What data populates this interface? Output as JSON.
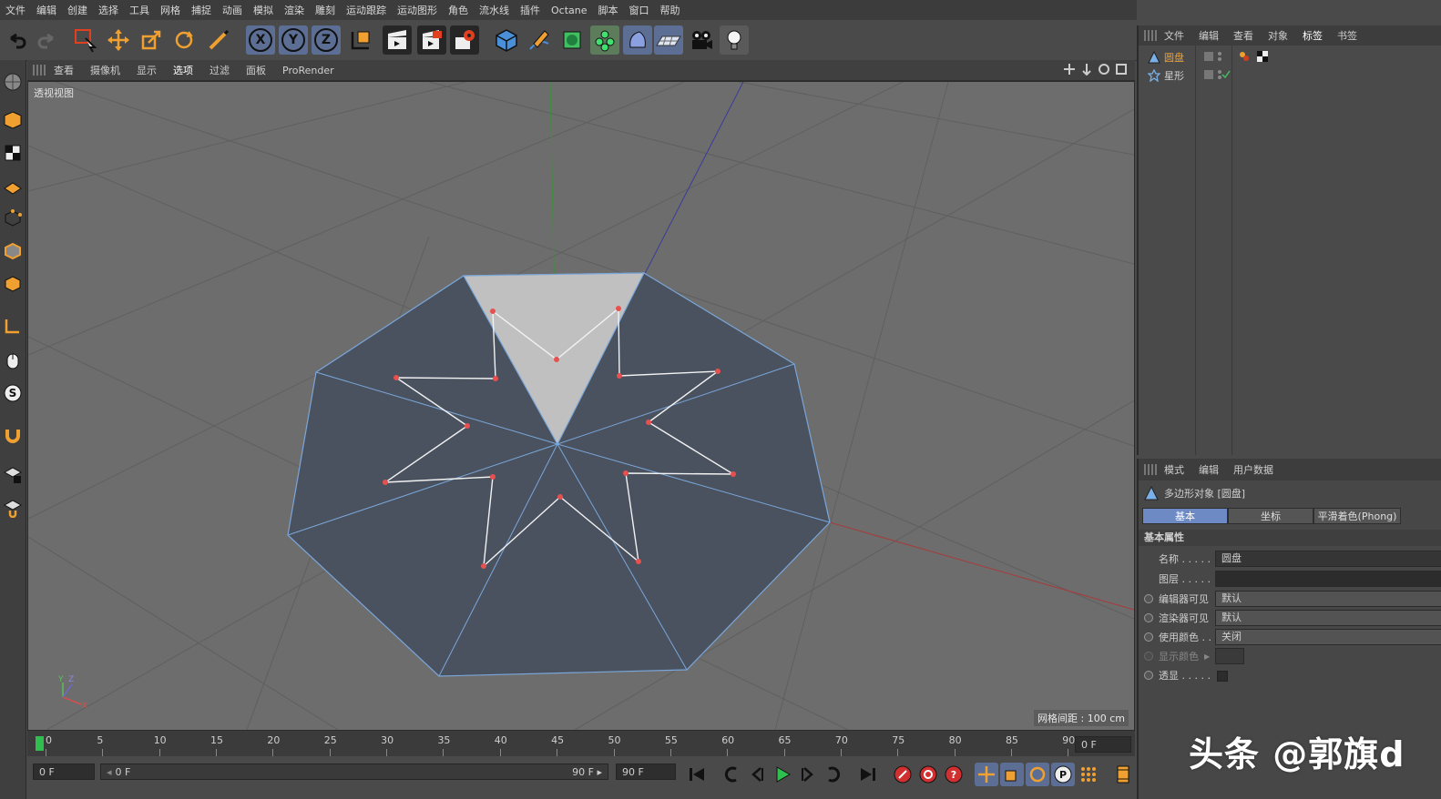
{
  "menu": [
    "文件",
    "编辑",
    "创建",
    "选择",
    "工具",
    "网格",
    "捕捉",
    "动画",
    "模拟",
    "渲染",
    "雕刻",
    "运动跟踪",
    "运动图形",
    "角色",
    "流水线",
    "插件",
    "Octane",
    "脚本",
    "窗口",
    "帮助"
  ],
  "toolbar": {
    "axis_x": "X",
    "axis_y": "Y",
    "axis_z": "Z"
  },
  "viewport_menu": [
    "查看",
    "摄像机",
    "显示",
    "选项",
    "过滤",
    "面板",
    "ProRender"
  ],
  "viewport": {
    "label": "透视视图",
    "grid_spacing": "网格间距 : 100 cm"
  },
  "timeline": {
    "ticks": [
      "0",
      "5",
      "10",
      "15",
      "20",
      "25",
      "30",
      "35",
      "40",
      "45",
      "50",
      "55",
      "60",
      "65",
      "70",
      "75",
      "80",
      "85",
      "90"
    ],
    "current_frame_right": "0 F",
    "start_field": "0 F",
    "range_start": "0 F",
    "range_end": "90 F",
    "end_field": "90 F"
  },
  "object_manager": {
    "tabs": [
      "文件",
      "编辑",
      "查看",
      "对象",
      "标签",
      "书签"
    ],
    "active_tab": "标签",
    "objects": [
      {
        "name": "圆盘",
        "selected": true
      },
      {
        "name": "星形",
        "selected": false
      }
    ]
  },
  "attributes": {
    "tabs": [
      "模式",
      "编辑",
      "用户数据"
    ],
    "object_title": "多边形对象 [圆盘]",
    "subtabs": [
      "基本",
      "坐标",
      "平滑着色(Phong)"
    ],
    "section": "基本属性",
    "props": [
      {
        "label": "名称 . . . . .",
        "value": "圆盘"
      },
      {
        "label": "图层 . . . . .",
        "value": ""
      },
      {
        "label": "编辑器可见",
        "value": "默认"
      },
      {
        "label": "渲染器可见",
        "value": "默认"
      },
      {
        "label": "使用颜色 . .",
        "value": "关闭"
      },
      {
        "label": "显示颜色",
        "value": ""
      },
      {
        "label": "透显 . . . . .",
        "value": ""
      }
    ]
  },
  "watermark": "头条 @郭旗d",
  "colors": {
    "accent_orange": "#f0a030",
    "selection_blue": "#6d8ac4",
    "polygon": "#4a5260",
    "edge": "#7aa6d8",
    "spline_point": "#e85050"
  }
}
